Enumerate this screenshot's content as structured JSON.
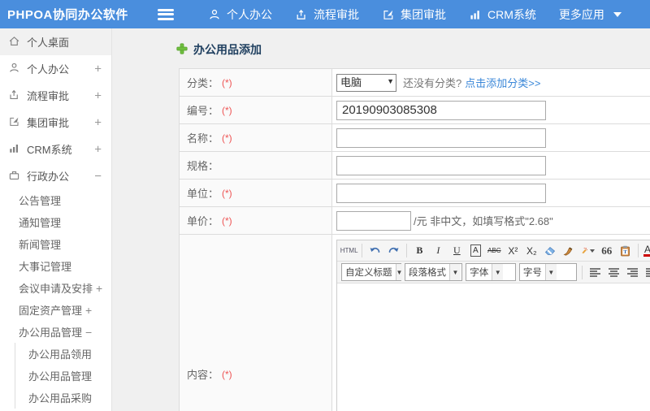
{
  "colors": {
    "navbar_bg": "#4a8edd",
    "link": "#3a87d8",
    "required": "#ee5555",
    "title": "#1f3f5f"
  },
  "navbar": {
    "brand": "PHPOA协同办公软件",
    "menu": [
      {
        "label": "个人办公",
        "icon": "user-icon"
      },
      {
        "label": "流程审批",
        "icon": "upload-icon"
      },
      {
        "label": "集团审批",
        "icon": "edit-icon"
      },
      {
        "label": "CRM系统",
        "icon": "bar-chart-icon"
      },
      {
        "label": "更多应用",
        "icon": "caret-down-icon"
      }
    ]
  },
  "sidebar": {
    "items": [
      {
        "label": "个人桌面",
        "toggle": "",
        "icon": "home-icon"
      },
      {
        "label": "个人办公",
        "toggle": "+",
        "icon": "user-icon"
      },
      {
        "label": "流程审批",
        "toggle": "+",
        "icon": "upload-icon"
      },
      {
        "label": "集团审批",
        "toggle": "+",
        "icon": "edit-icon"
      },
      {
        "label": "CRM系统",
        "toggle": "+",
        "icon": "bar-chart-icon"
      },
      {
        "label": "行政办公",
        "toggle": "−",
        "icon": "briefcase-icon"
      }
    ],
    "admin_children": [
      {
        "label": "公告管理",
        "toggle": ""
      },
      {
        "label": "通知管理",
        "toggle": ""
      },
      {
        "label": "新闻管理",
        "toggle": ""
      },
      {
        "label": "大事记管理",
        "toggle": ""
      },
      {
        "label": "会议申请及安排",
        "toggle": "+"
      },
      {
        "label": "固定资产管理",
        "toggle": "+"
      },
      {
        "label": "办公用品管理",
        "toggle": "−"
      }
    ],
    "supplies_children": [
      {
        "label": "办公用品领用"
      },
      {
        "label": "办公用品管理"
      },
      {
        "label": "办公用品采购"
      }
    ]
  },
  "main": {
    "page_title": "办公用品添加",
    "form": {
      "category": {
        "label": "分类：",
        "required": "(*)",
        "select_value": "电脑",
        "hint": "还没有分类?",
        "link": "点击添加分类>>"
      },
      "code": {
        "label": "编号：",
        "required": "(*)",
        "value": "20190903085308"
      },
      "name": {
        "label": "名称：",
        "required": "(*)",
        "value": ""
      },
      "spec": {
        "label": "规格：",
        "required": "",
        "value": ""
      },
      "unit": {
        "label": "单位：",
        "required": "(*)",
        "value": ""
      },
      "price": {
        "label": "单价：",
        "required": "(*)",
        "value": "",
        "suffix": "/元 非中文，如填写格式\"2.68\""
      },
      "content": {
        "label": "内容：",
        "required": "(*)"
      }
    }
  },
  "editor": {
    "glyphs": {
      "html": "HTML",
      "bold": "B",
      "italic": "I",
      "underline": "U",
      "font_box": "A",
      "strike": "ABC",
      "superscript": "X²",
      "subscript": "X₂",
      "quote": "66",
      "forecolor": "A",
      "hilitecolor": "ab",
      "link": "∞"
    },
    "selects": [
      {
        "label": "自定义标题"
      },
      {
        "label": "段落格式"
      },
      {
        "label": "字体"
      },
      {
        "label": "字号"
      }
    ]
  }
}
